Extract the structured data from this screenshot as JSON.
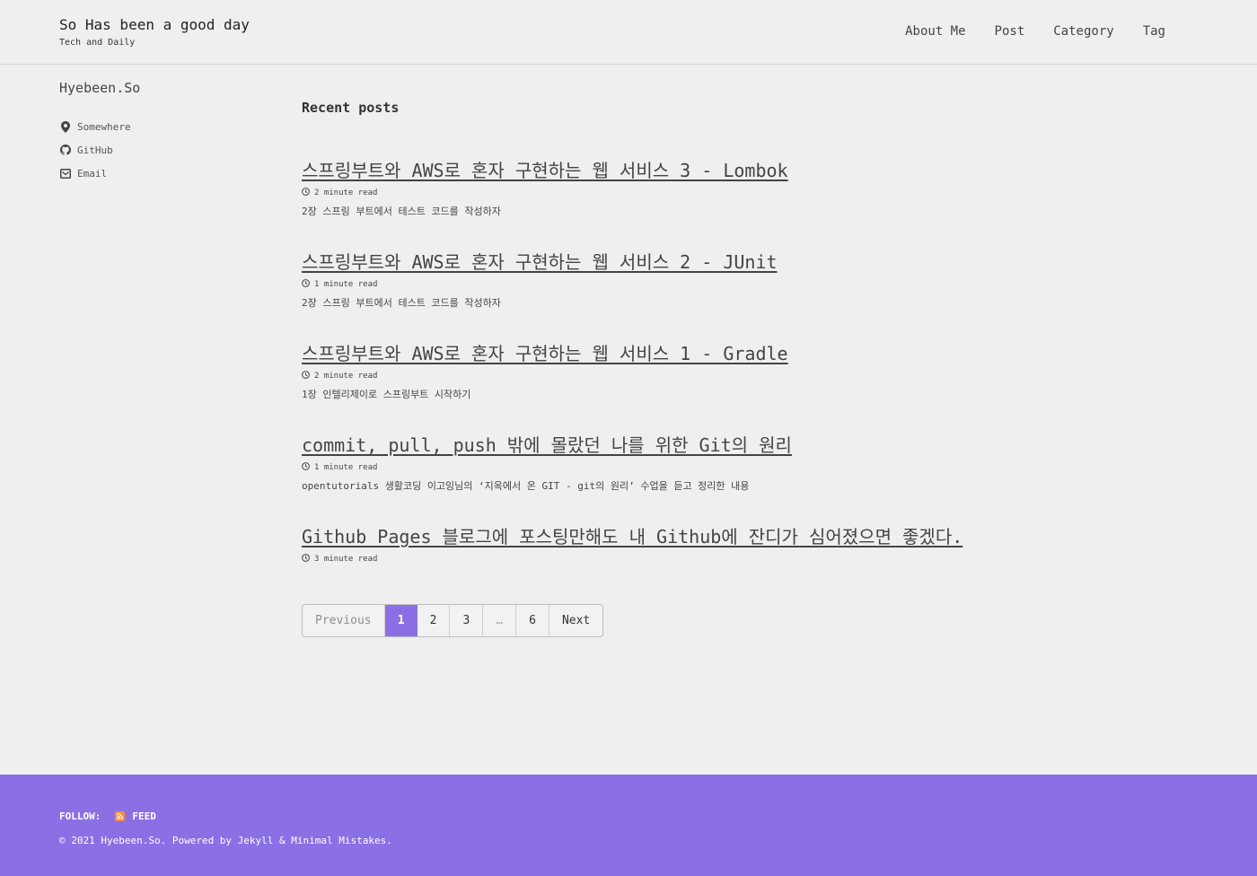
{
  "masthead": {
    "title": "So Has been a good day",
    "subtitle": "Tech and Daily",
    "nav": [
      "About Me",
      "Post",
      "Category",
      "Tag"
    ]
  },
  "sidebar": {
    "author": "Hyebeen.So",
    "links": [
      {
        "icon": "location-pin-icon",
        "label": "Somewhere"
      },
      {
        "icon": "github-icon",
        "label": "GitHub"
      },
      {
        "icon": "email-icon",
        "label": "Email"
      }
    ]
  },
  "main": {
    "section_title": "Recent posts",
    "posts": [
      {
        "title": "스프링부트와 AWS로 혼자 구현하는 웹 서비스 3 - Lombok",
        "read_time": "2 minute read",
        "excerpt": "2장 스프링 부트에서 테스트 코드를 작성하자"
      },
      {
        "title": "스프링부트와 AWS로 혼자 구현하는 웹 서비스 2 - JUnit",
        "read_time": "1 minute read",
        "excerpt": "2장 스프링 부트에서 테스트 코드를 작성하자"
      },
      {
        "title": "스프링부트와 AWS로 혼자 구현하는 웹 서비스 1 - Gradle",
        "read_time": "2 minute read",
        "excerpt": "1장 인텔리제이로 스프링부트 시작하기"
      },
      {
        "title": "commit, pull, push 밖에 몰랐던 나를 위한 Git의 원리",
        "read_time": "1 minute read",
        "excerpt": "opentutorials 생활코딩 이고잉님의 ‘지옥에서 온 GIT - git의 원리’ 수업을 듣고 정리한 내용"
      },
      {
        "title": "Github Pages 블로그에 포스팅만해도 내 Github에 잔디가 심어졌으면 좋겠다.",
        "read_time": "3 minute read",
        "excerpt": ""
      }
    ]
  },
  "pagination": {
    "previous": "Previous",
    "pages": [
      "1",
      "2",
      "3"
    ],
    "ellipsis": "…",
    "last": "6",
    "next": "Next",
    "current": "1"
  },
  "footer": {
    "follow_label": "FOLLOW:",
    "feed_label": "FEED",
    "copyright": "© 2021 Hyebeen.So. Powered by Jekyll & Minimal Mistakes."
  },
  "colors": {
    "accent": "#8a70e4",
    "background": "#efefef",
    "rss": "#f48d3c"
  }
}
